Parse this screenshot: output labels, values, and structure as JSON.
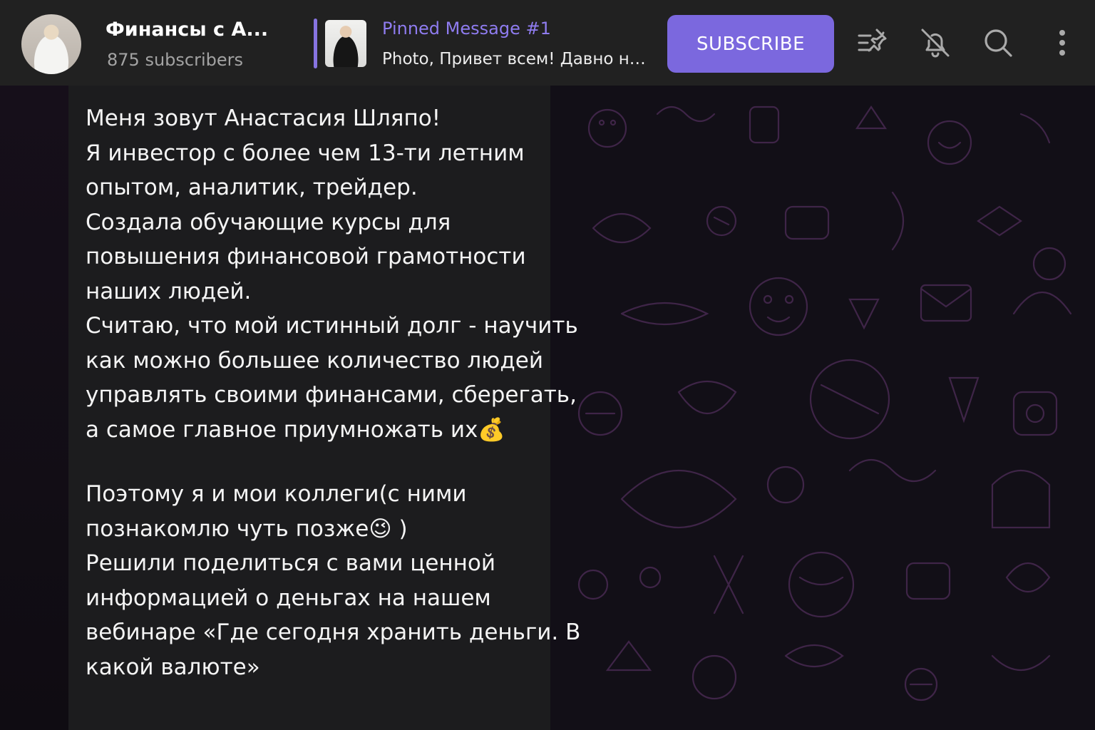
{
  "header": {
    "channel_title": "Финансы с А...",
    "subscribers": "875 subscribers",
    "pinned_title": "Pinned Message #1",
    "pinned_text": "Photo, Привет всем! Давно не ...",
    "subscribe_label": "SUBSCRIBE",
    "icons": [
      "pinned-list-icon",
      "bell-muted-icon",
      "search-icon",
      "more-vertical-icon"
    ]
  },
  "message": {
    "lines_part1": [
      "Меня зовут Анастасия Шляпо!",
      "Я инвестор с более чем 13-ти летним",
      "опытом, аналитик, трейдер.",
      "Создала обучающие курсы для",
      "повышения финансовой грамотности",
      "наших людей.",
      "Считаю, что мой истинный долг - научить",
      "как можно большее количество людей",
      "управлять своими финансами, сберегать,",
      "а самое главное приумножать их💰"
    ],
    "lines_part2": [
      "Поэтому я и мои коллеги(с ними",
      "познакомлю чуть позже😉 )",
      "Решили поделиться с вами ценной",
      "информацией о деньгах на нашем",
      "вебинаре «Где сегодня хранить деньги. В",
      "какой валюте»"
    ]
  },
  "colors": {
    "header_bg": "#212121",
    "accent": "#7b68de",
    "pinned_accent": "#8f7cf0",
    "message_bg": "#1c1c1e",
    "wallpaper_doodle": "#4a2b55"
  }
}
